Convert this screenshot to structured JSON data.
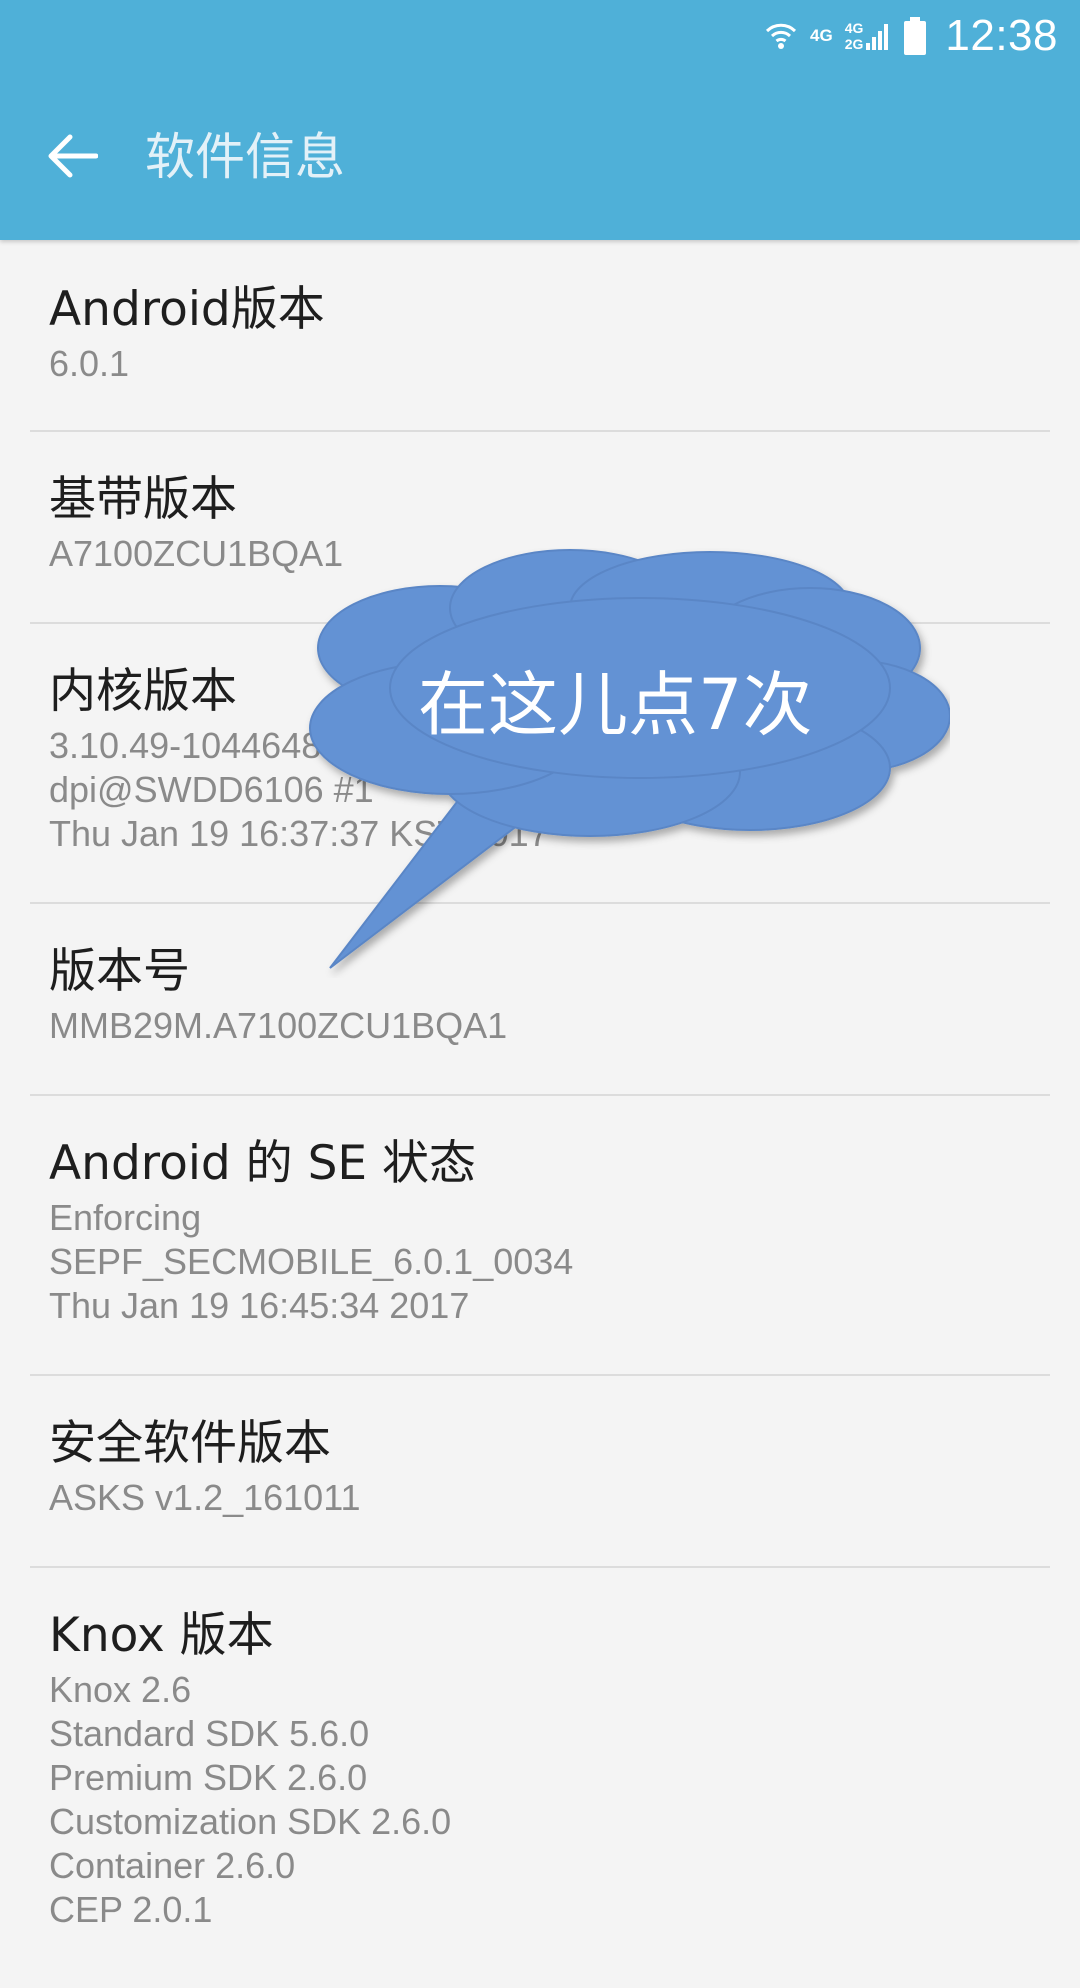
{
  "status_bar": {
    "network_1": "4G",
    "network_2_top": "4G",
    "network_2_bottom": "2G",
    "time": "12:38",
    "icons": [
      "wifi-icon",
      "signal-icon",
      "battery-icon"
    ]
  },
  "app_bar": {
    "title": "软件信息",
    "back_icon": "arrow-left-icon",
    "color": "#4fb0d8"
  },
  "items": [
    {
      "title": "Android版本",
      "lines": [
        "6.0.1"
      ]
    },
    {
      "title": "基带版本",
      "lines": [
        "A7100ZCU1BQA1"
      ]
    },
    {
      "title": "内核版本",
      "lines": [
        "3.10.49-10446483",
        "dpi@SWDD6106 #1",
        "Thu Jan 19 16:37:37 KST 2017"
      ]
    },
    {
      "title": "版本号",
      "lines": [
        "MMB29M.A7100ZCU1BQA1"
      ]
    },
    {
      "title": "Android 的 SE 状态",
      "lines": [
        "Enforcing",
        "SEPF_SECMOBILE_6.0.1_0034",
        "Thu Jan 19 16:45:34 2017"
      ]
    },
    {
      "title": "安全软件版本",
      "lines": [
        "ASKS v1.2_161011"
      ]
    },
    {
      "title": "Knox 版本",
      "lines": [
        "Knox 2.6",
        "Standard SDK 5.6.0",
        "Premium SDK 2.6.0",
        "Customization SDK 2.6.0",
        "Container 2.6.0",
        "CEP 2.0.1"
      ]
    }
  ],
  "callout": {
    "text": "在这儿点7次",
    "color": "#6492d4"
  }
}
